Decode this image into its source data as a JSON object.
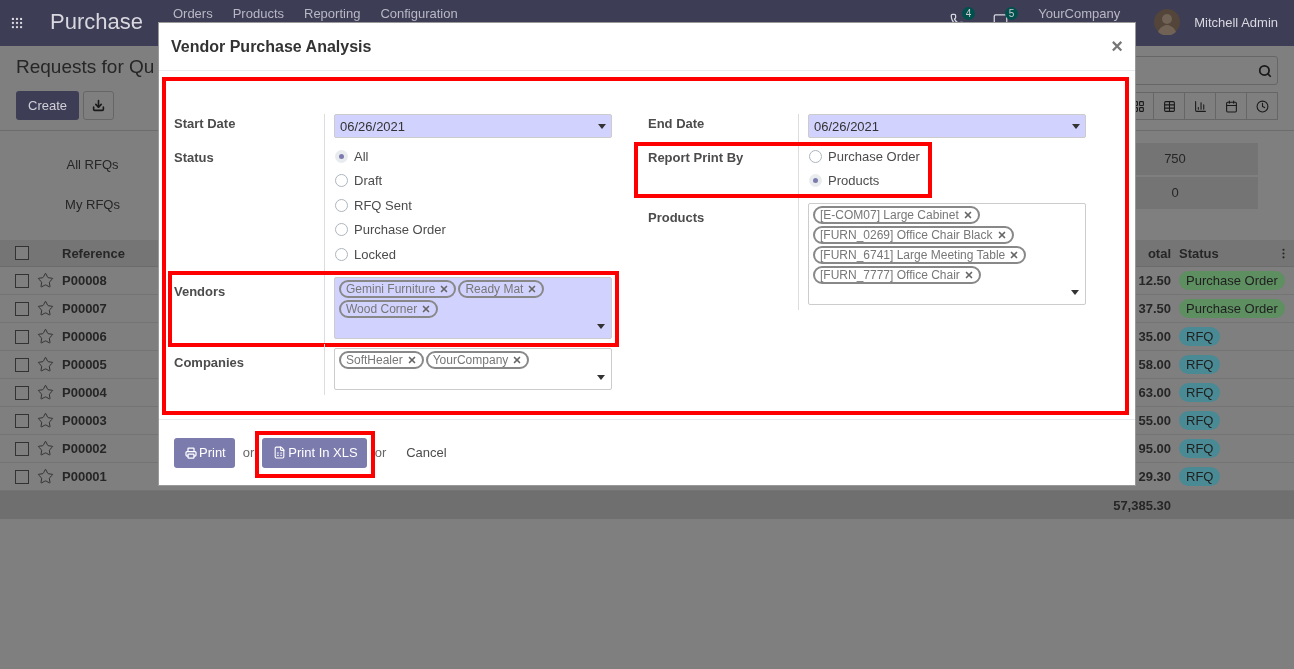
{
  "navbar": {
    "app_name": "Purchase",
    "menu": [
      "Orders",
      "Products",
      "Reporting",
      "Configuration"
    ],
    "activity_count": "4",
    "message_count": "5",
    "company": "YourCompany",
    "user": "Mitchell Admin"
  },
  "control_panel": {
    "title": "Requests for Qu",
    "create_button": "Create"
  },
  "dashboard": [
    {
      "label": "All RFQs",
      "value": "750"
    },
    {
      "label": "My RFQs",
      "value": "0"
    }
  ],
  "table": {
    "columns": [
      "Reference",
      "otal",
      "Status"
    ],
    "header_checked": false,
    "rows": [
      {
        "reference": "P00008",
        "total": "12.50",
        "status": "Purchase Order",
        "color": "#5e8f61",
        "checked": false
      },
      {
        "reference": "P00007",
        "total": "37.50",
        "status": "Purchase Order",
        "color": "#5e8f61",
        "checked": false
      },
      {
        "reference": "P00006",
        "total": "35.00",
        "status": "RFQ",
        "color": "#4a8a94",
        "checked": false
      },
      {
        "reference": "P00005",
        "total": "58.00",
        "status": "RFQ",
        "color": "#4a8a94",
        "checked": false
      },
      {
        "reference": "P00004",
        "total": "63.00",
        "status": "RFQ",
        "color": "#4a8a94",
        "checked": false
      },
      {
        "reference": "P00003",
        "total": "55.00",
        "status": "RFQ",
        "color": "#4a8a94",
        "checked": false
      },
      {
        "reference": "P00002",
        "total": "95.00",
        "status": "RFQ",
        "color": "#4a8a94",
        "checked": false
      },
      {
        "reference": "P00001",
        "total": "29.30",
        "status": "RFQ",
        "color": "#4a8a94",
        "checked": false
      }
    ],
    "footer_total": "57,385.30"
  },
  "dialog": {
    "title": "Vendor Purchase Analysis",
    "close": "×",
    "highlighted": true,
    "left": [
      {
        "kind": "date",
        "label": "Start Date",
        "value": "06/26/2021",
        "required": true,
        "highlighted": false
      },
      {
        "kind": "radio",
        "label": "Status",
        "highlighted": false,
        "options": [
          {
            "label": "All",
            "selected": true
          },
          {
            "label": "Draft",
            "selected": false
          },
          {
            "label": "RFQ Sent",
            "selected": false
          },
          {
            "label": "Purchase Order",
            "selected": false
          },
          {
            "label": "Locked",
            "selected": false
          }
        ]
      },
      {
        "kind": "tags",
        "label": "Vendors",
        "required": true,
        "highlighted": true,
        "tags": [
          "Gemini Furniture",
          "Ready Mat",
          "Wood Corner"
        ]
      },
      {
        "kind": "tags",
        "label": "Companies",
        "required": false,
        "highlighted": false,
        "tags": [
          "SoftHealer",
          "YourCompany"
        ]
      }
    ],
    "right": [
      {
        "kind": "date",
        "label": "End Date",
        "value": "06/26/2021",
        "required": true,
        "highlighted": false
      },
      {
        "kind": "radio",
        "label": "Report Print By",
        "highlighted": true,
        "options": [
          {
            "label": "Purchase Order",
            "selected": false
          },
          {
            "label": "Products",
            "selected": true
          }
        ]
      },
      {
        "kind": "tags",
        "label": "Products",
        "required": false,
        "highlighted": false,
        "tags": [
          "[E-COM07] Large Cabinet",
          "[FURN_0269] Office Chair Black",
          "[FURN_6741] Large Meeting Table",
          "[FURN_7777] Office Chair"
        ]
      }
    ],
    "footer": [
      {
        "kind": "print",
        "label": "Print",
        "highlighted": false
      },
      {
        "kind": "text",
        "label": "or"
      },
      {
        "kind": "xls",
        "label": "Print In XLS",
        "highlighted": true
      },
      {
        "kind": "text",
        "label": "or"
      },
      {
        "kind": "link",
        "label": "Cancel"
      }
    ]
  }
}
